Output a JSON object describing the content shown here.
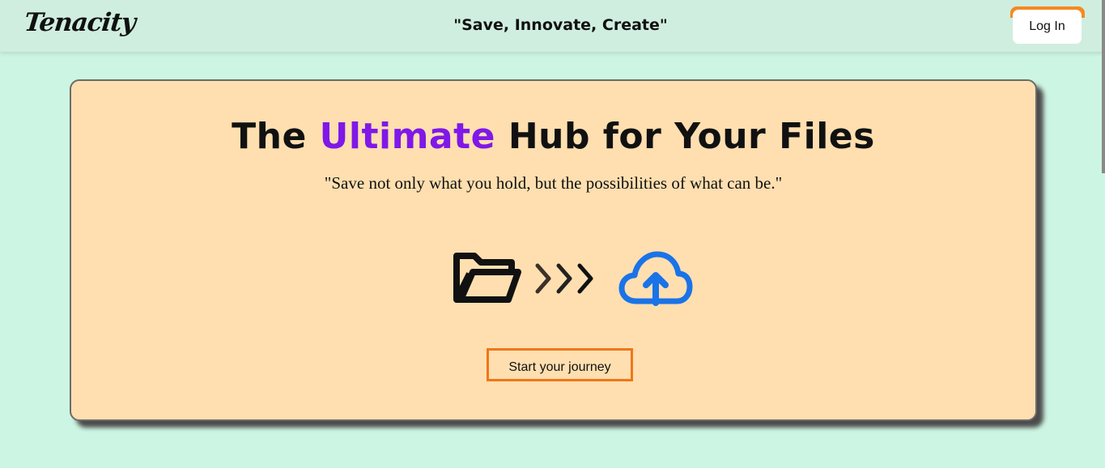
{
  "header": {
    "logo": "Tenacity",
    "tagline": "\"Save, Innovate, Create\"",
    "login_label": "Log In"
  },
  "hero": {
    "title_before": "The ",
    "title_accent": "Ultimate",
    "title_after": " Hub for Your Files",
    "quote": "\"Save not only what you hold, but the possibilities of what can be.\"",
    "cta_label": "Start your journey",
    "icons": [
      "folder-open-icon",
      "triple-chevron-right-icon",
      "cloud-upload-icon"
    ]
  },
  "colors": {
    "background": "#cdf5e3",
    "header": "#cfeee0",
    "hero_card": "#ffdfb0",
    "accent_purple": "#7f18e8",
    "accent_orange": "#f0761a",
    "cloud_blue": "#1a73e8"
  }
}
